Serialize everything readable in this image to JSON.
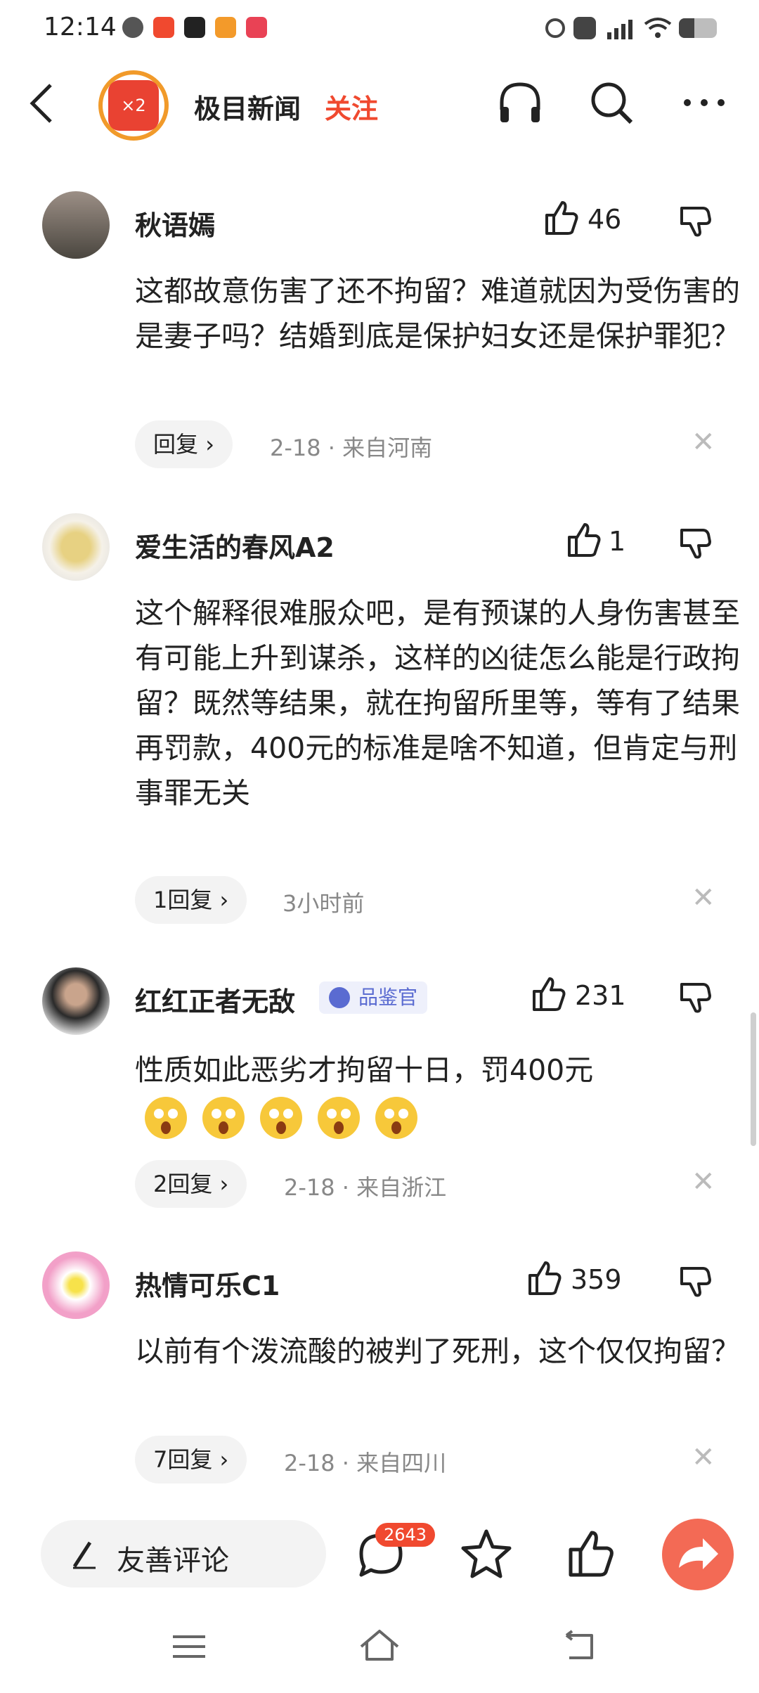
{
  "status_bar": {
    "time": "12:14"
  },
  "header": {
    "brand": "极目新闻",
    "follow_label": "关注",
    "avatar_badge": "×2"
  },
  "comments": [
    {
      "name": "秋语嫣",
      "likes": "46",
      "text": "这都故意伤害了还不拘留？难道就因为受伤害的是妻子吗？结婚到底是保护妇女还是保护罪犯？",
      "reply_label": "回复",
      "meta": "2-18 · 来自河南"
    },
    {
      "name": "爱生活的春风A2",
      "likes": "1",
      "text": "这个解释很难服众吧，是有预谋的人身伤害甚至有可能上升到谋杀，这样的凶徒怎么能是行政拘留？既然等结果，就在拘留所里等，等有了结果再罚款，400元的标准是啥不知道，但肯定与刑事罪无关",
      "reply_label": "1回复",
      "meta": "3小时前"
    },
    {
      "name": "红红正者无敌",
      "badge": "品鉴官",
      "likes": "231",
      "text": "性质如此恶劣才拘留十日，罚400元",
      "reply_label": "2回复",
      "meta": "2-18 · 来自浙江"
    },
    {
      "name": "热情可乐C1",
      "likes": "359",
      "text": "以前有个泼流酸的被判了死刑，这个仅仅拘留？",
      "reply_label": "7回复",
      "meta": "2-18 · 来自四川"
    }
  ],
  "bottom_bar": {
    "comment_placeholder": "友善评论",
    "comment_count": "2643"
  },
  "colors": {
    "accent": "#f0492f",
    "share": "#f36a55",
    "ring": "#f19a2a"
  },
  "icons": [
    "back-icon",
    "headphones-icon",
    "search-icon",
    "more-icon",
    "thumbs-up-icon",
    "thumbs-down-icon",
    "close-icon",
    "pen-icon",
    "comment-icon",
    "star-icon",
    "share-icon",
    "menu-icon",
    "home-icon",
    "return-icon"
  ]
}
